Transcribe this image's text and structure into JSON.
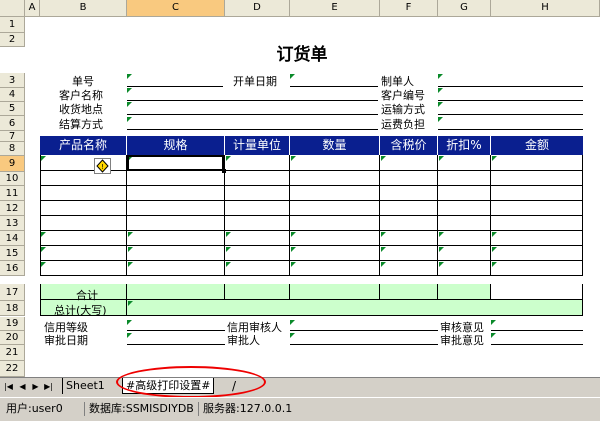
{
  "columns": [
    "A",
    "B",
    "C",
    "D",
    "E",
    "F",
    "G",
    "H"
  ],
  "rows": [
    "1",
    "2",
    "3",
    "4",
    "5",
    "6",
    "7",
    "8",
    "9",
    "10",
    "11",
    "12",
    "13",
    "14",
    "15",
    "16",
    "17",
    "18",
    "19",
    "20",
    "21",
    "22"
  ],
  "title": "订货单",
  "labels": {
    "order_no": "单号",
    "open_date": "开单日期",
    "maker": "制单人",
    "customer_name": "客户名称",
    "customer_code": "客户编号",
    "delivery_place": "收货地点",
    "transport": "运输方式",
    "settlement": "结算方式",
    "freight": "运费负担",
    "total": "合计",
    "total_upper": "总计(大写)",
    "credit_level": "信用等级",
    "credit_review": "信用审核人",
    "review_opinion": "审核意见",
    "approve_date": "审批日期",
    "approver": "审批人",
    "approve_opinion": "审批意见"
  },
  "table_headers": [
    "产品名称",
    "规格",
    "计量单位",
    "数量",
    "含税价",
    "折扣%",
    "金额"
  ],
  "tabs": [
    "Sheet1",
    "#高级打印设置#"
  ],
  "status": {
    "user": "用户:user0",
    "db": "数据库:SSMISDIYDB",
    "server": "服务器:127.0.0.1"
  }
}
